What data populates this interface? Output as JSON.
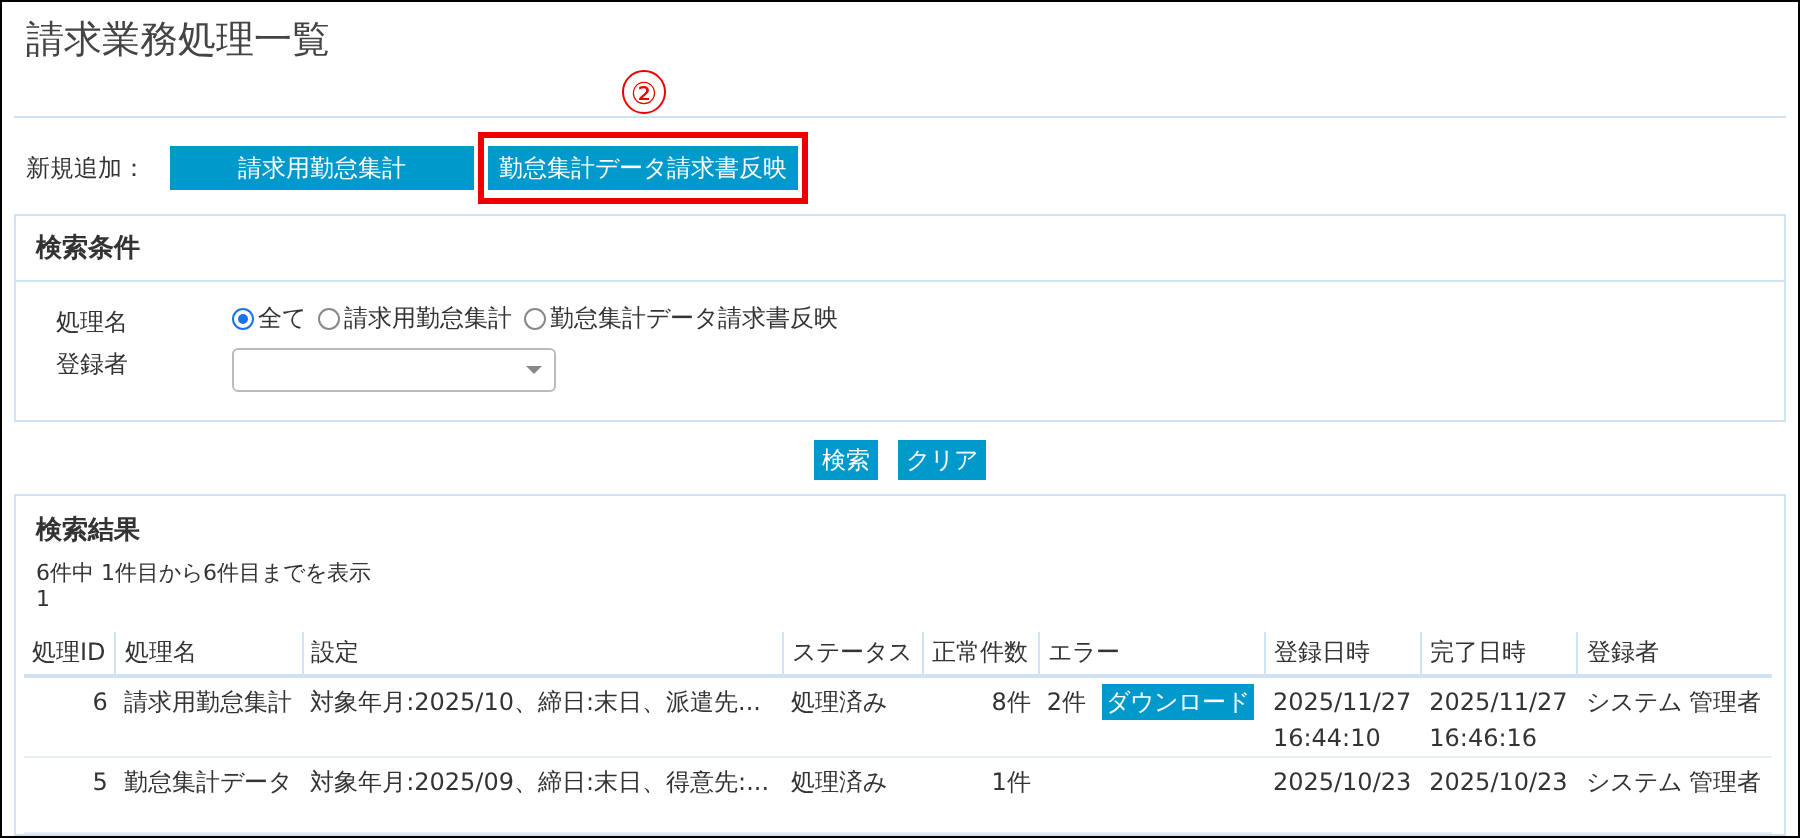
{
  "page": {
    "title": "請求業務処理一覧"
  },
  "new_add": {
    "label": "新規追加：",
    "buttons": [
      {
        "label": "請求用勤怠集計",
        "highlighted": false
      },
      {
        "label": "勤怠集計データ請求書反映",
        "highlighted": true
      }
    ]
  },
  "annotation": {
    "label": "②"
  },
  "search_panel": {
    "title": "検索条件",
    "process_name": {
      "label": "処理名",
      "options": [
        {
          "label": "全て",
          "selected": true
        },
        {
          "label": "請求用勤怠集計",
          "selected": false
        },
        {
          "label": "勤怠集計データ請求書反映",
          "selected": false
        }
      ]
    },
    "registrant": {
      "label": "登録者"
    }
  },
  "search_buttons": [
    "検索",
    "クリア"
  ],
  "results": {
    "title": "検索結果",
    "summary": "6件中 1件目から6件目までを表示",
    "page": "1",
    "table": {
      "columns": [
        "処理ID",
        "処理名",
        "設定",
        "ステータス",
        "正常件数",
        "エラー",
        "登録日時",
        "完了日時",
        "登録者"
      ],
      "rows": [
        {
          "id": "6",
          "name": "請求用勤怠集計",
          "settings": "対象年月:2025/10、締日:末日、派遣先...",
          "status": "処理済み",
          "normal_count": "8件",
          "error_count": "2件",
          "error_action": "ダウンロード",
          "registered": [
            "2025/11/27",
            "16:44:10"
          ],
          "completed": [
            "2025/11/27",
            "16:46:16"
          ],
          "registrant": "システム 管理者"
        },
        {
          "id": "5",
          "name": "勤怠集計データ",
          "settings": "対象年月:2025/09、締日:末日、得意先:...",
          "status": "処理済み",
          "normal_count": "1件",
          "error_count": "",
          "registered": [
            "2025/10/23"
          ],
          "completed": [
            "2025/10/23"
          ],
          "registrant": "システム 管理者"
        }
      ]
    }
  }
}
